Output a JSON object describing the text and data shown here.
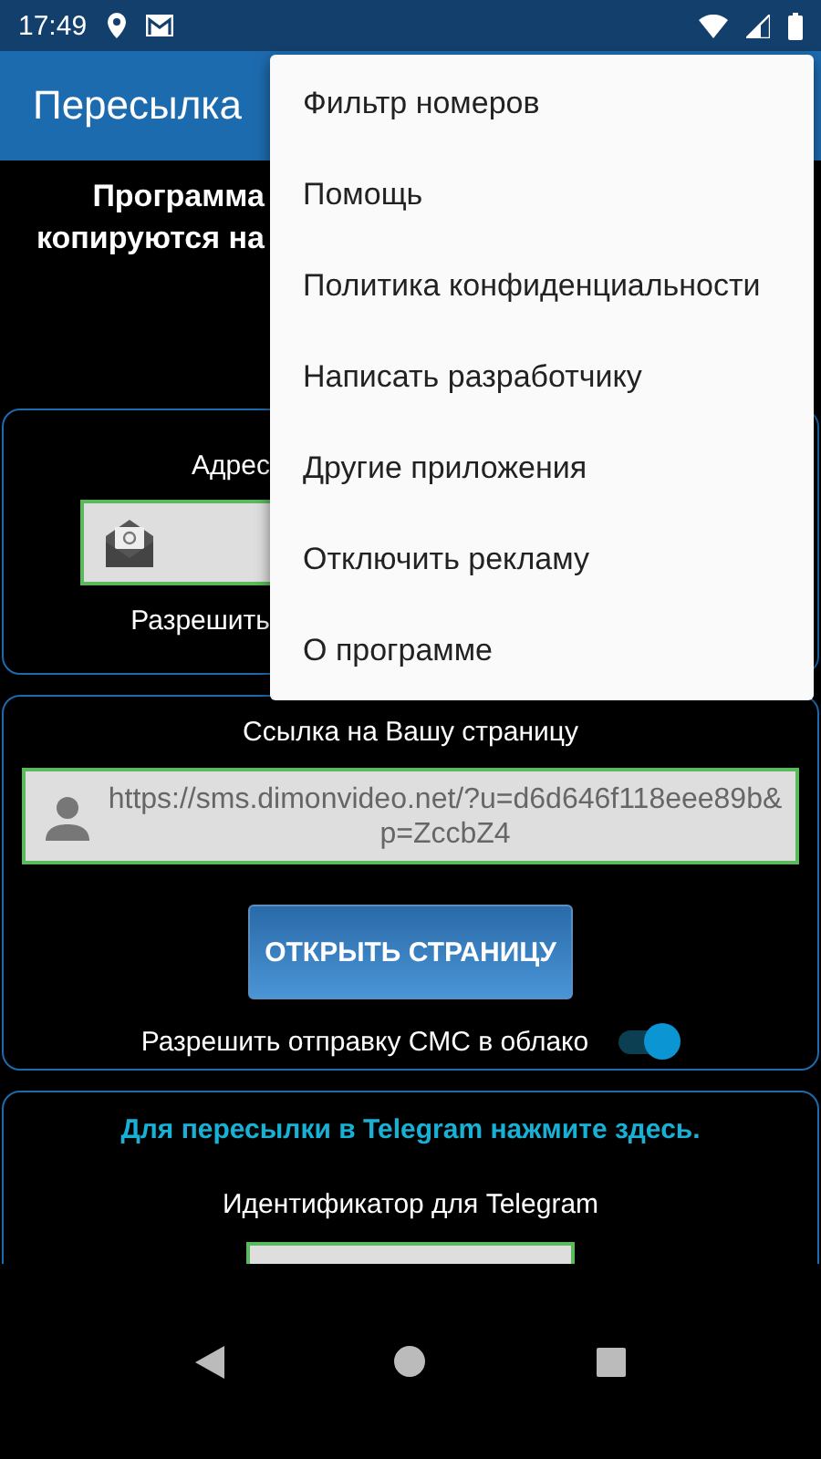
{
  "status_bar": {
    "time": "17:49"
  },
  "app_bar": {
    "title": "Пересылка"
  },
  "intro": [
    "Программа",
    "копируются на"
  ],
  "email_card": {
    "label": "Адрес",
    "toggle_label": "Разрешить"
  },
  "page_card": {
    "label": "Ссылка на Вашу страницу",
    "url": "https://sms.dimonvideo.net/?u=d6d646f118eee89b&p=ZccbZ4",
    "button": "ОТКРЫТЬ СТРАНИЦУ",
    "toggle_label": "Разрешить отправку СМС в облако",
    "toggle_on": true
  },
  "telegram_card": {
    "link": "Для пересылки в Telegram нажмите здесь.",
    "label": "Идентификатор для Telegram"
  },
  "menu": {
    "items": [
      "Фильтр номеров",
      "Помощь",
      "Политика конфиденциальности",
      "Написать разработчику",
      "Другие приложения",
      "Отключить рекламу",
      "О программе"
    ]
  }
}
